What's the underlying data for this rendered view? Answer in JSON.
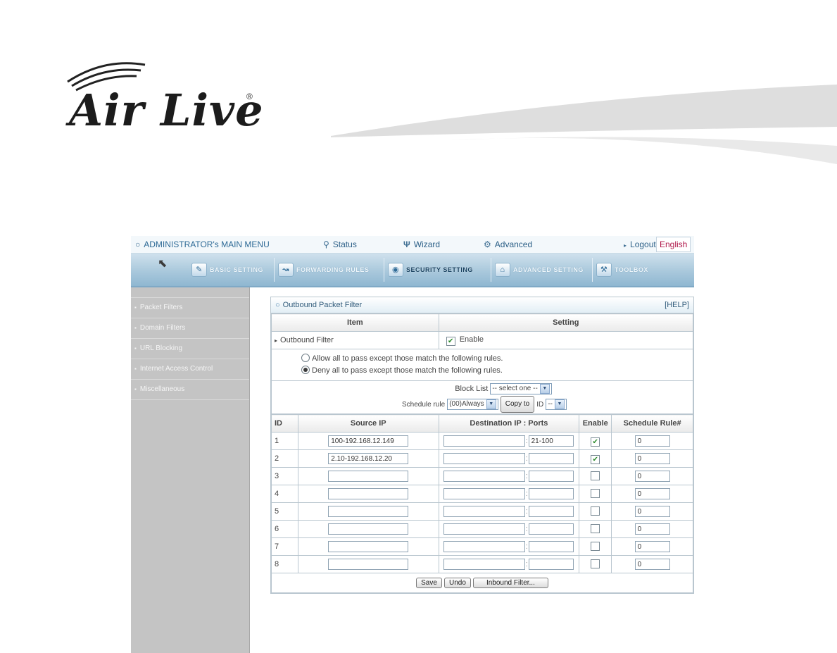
{
  "brand": {
    "name": "Air Live",
    "reg_mark": "®"
  },
  "topbar": {
    "menu_title": "ADMINISTRATOR's MAIN MENU",
    "status": "Status",
    "wizard": "Wizard",
    "advanced": "Advanced",
    "logout": "Logout",
    "language": "English"
  },
  "tabs": [
    {
      "label": "BASIC SETTING",
      "icon": "basic-setting-icon"
    },
    {
      "label": "FORWARDING RULES",
      "icon": "forwarding-icon"
    },
    {
      "label": "SECURITY SETTING",
      "icon": "security-icon",
      "active": true
    },
    {
      "label": "ADVANCED SETTING",
      "icon": "advanced-icon"
    },
    {
      "label": "TOOLBOX",
      "icon": "toolbox-icon"
    }
  ],
  "sidebar": {
    "items": [
      "Packet Filters",
      "Domain Filters",
      "URL Blocking",
      "Internet Access Control",
      "Miscellaneous"
    ]
  },
  "panel": {
    "title": "Outbound Packet Filter",
    "help": "[HELP]",
    "col_item": "Item",
    "col_setting": "Setting",
    "filter_label": "Outbound Filter",
    "enable_label": "Enable",
    "allow_text": "Allow all to pass except those match the following rules.",
    "deny_text": "Deny all to pass except those match the following rules.",
    "block_list_label": "Block List",
    "block_list_value": "-- select one --",
    "schedule_label": "Schedule rule",
    "schedule_value": "(00)Always",
    "copy_to": "Copy to",
    "id_label": "ID",
    "id_value": "--"
  },
  "rules_table": {
    "headers": [
      "ID",
      "Source IP",
      "Destination IP : Ports",
      "Enable",
      "Schedule Rule#"
    ],
    "rows": [
      {
        "id": "1",
        "source_ip": "100-192.168.12.149",
        "dest_ip": "",
        "ports": "21-100",
        "enabled": true,
        "schedule": "0"
      },
      {
        "id": "2",
        "source_ip": "2.10-192.168.12.20",
        "dest_ip": "",
        "ports": "",
        "enabled": true,
        "schedule": "0"
      },
      {
        "id": "3",
        "source_ip": "",
        "dest_ip": "",
        "ports": "",
        "enabled": false,
        "schedule": "0"
      },
      {
        "id": "4",
        "source_ip": "",
        "dest_ip": "",
        "ports": "",
        "enabled": false,
        "schedule": "0"
      },
      {
        "id": "5",
        "source_ip": "",
        "dest_ip": "",
        "ports": "",
        "enabled": false,
        "schedule": "0"
      },
      {
        "id": "6",
        "source_ip": "",
        "dest_ip": "",
        "ports": "",
        "enabled": false,
        "schedule": "0"
      },
      {
        "id": "7",
        "source_ip": "",
        "dest_ip": "",
        "ports": "",
        "enabled": false,
        "schedule": "0"
      },
      {
        "id": "8",
        "source_ip": "",
        "dest_ip": "",
        "ports": "",
        "enabled": false,
        "schedule": "0"
      }
    ]
  },
  "actions": {
    "save": "Save",
    "undo": "Undo",
    "inbound": "Inbound Filter..."
  },
  "colors": {
    "link_blue": "#2a5e86",
    "tab_blue": "#a9c8dc",
    "sidebar_gray": "#c4c4c4",
    "language_red": "#b0174a"
  }
}
